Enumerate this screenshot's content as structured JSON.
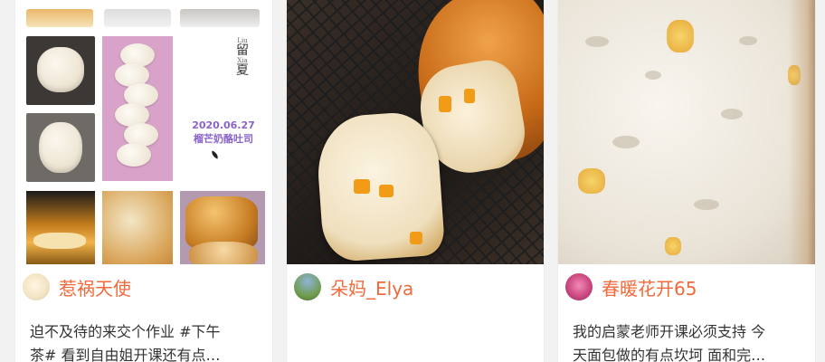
{
  "colors": {
    "author_name": "#f06a3b",
    "body_text": "#333333",
    "collage_caption": "#8a63c9",
    "background": "#f2f2f2",
    "card": "#ffffff"
  },
  "cards": [
    {
      "cover_caption": {
        "vertical_text": [
          "Liu",
          "留",
          "Xia",
          "夏"
        ],
        "date": "2020.06.27",
        "title": "榴芒奶酪吐司"
      },
      "author": {
        "name": "惹祸天使"
      },
      "description": {
        "line1": "迫不及待的来交个作业 #下午",
        "line2": "茶# 看到自由姐开课还有点…"
      }
    },
    {
      "author": {
        "name": "朵妈_Elya"
      },
      "description": {
        "line1": "",
        "line2": ""
      }
    },
    {
      "author": {
        "name": "春暖花开65"
      },
      "description": {
        "line1": "我的启蒙老师开课必须支持 今",
        "line2": "天面包做的有点坎坷 面和完…"
      }
    }
  ]
}
